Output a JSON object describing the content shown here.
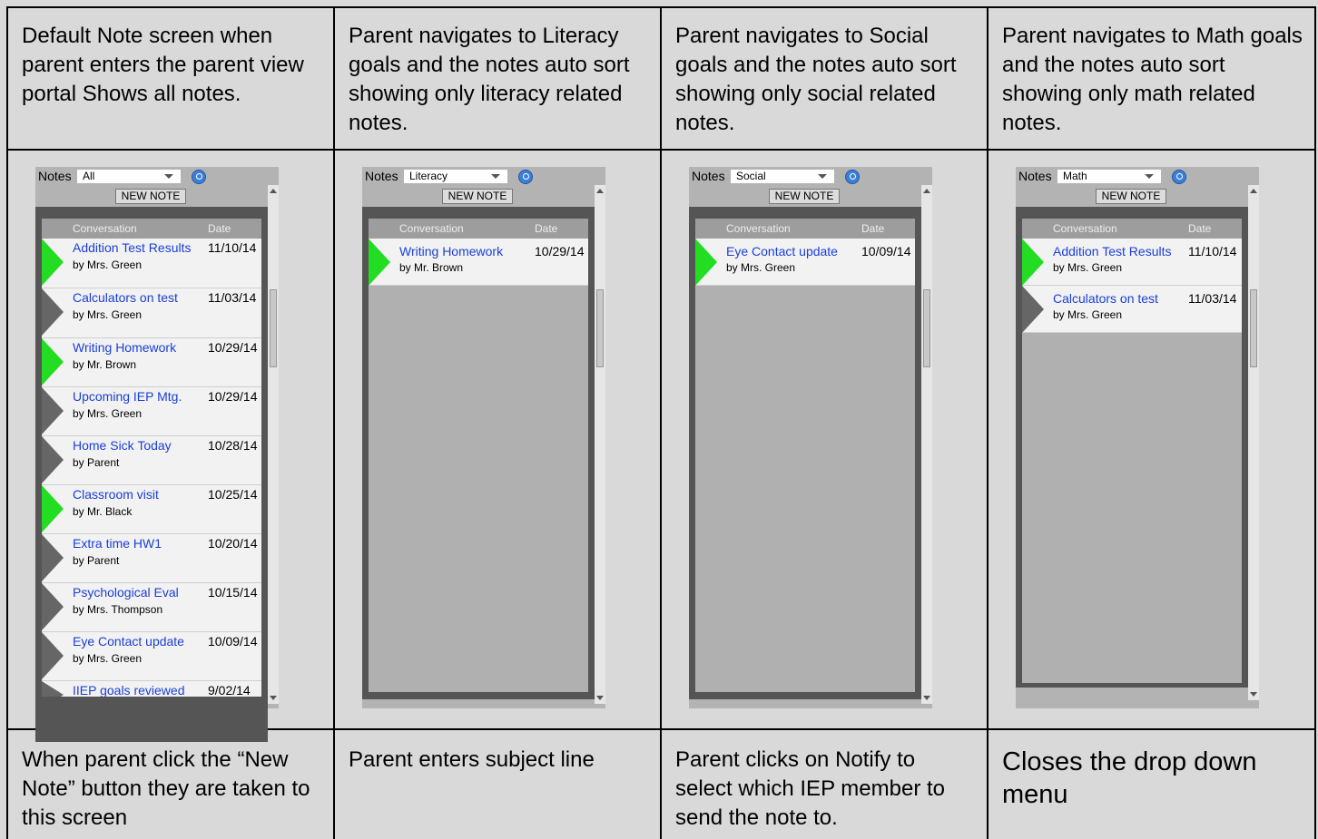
{
  "top_row": [
    "Default Note screen when parent enters the parent view portal Shows all notes.",
    "Parent navigates to Literacy goals and the notes  auto sort showing only literacy related notes.",
    "Parent navigates to Social goals and the notes  auto sort showing only social related notes.",
    "Parent navigates to Math goals and the notes  auto sort showing only math related notes."
  ],
  "bottom_row": [
    "When parent click the “New Note” button they are taken to this screen",
    "Parent enters subject line",
    "Parent clicks on Notify to select which IEP member to send the note to.",
    "Closes the drop down menu"
  ],
  "common": {
    "notes_label": "Notes",
    "new_note_label": "NEW NOTE",
    "col_conversation": "Conversation",
    "col_date": "Date",
    "search_icon": "search-icon",
    "colors": {
      "link": "#1a3fd8",
      "arrow_active": "#22dd22",
      "arrow_inactive": "#666666"
    }
  },
  "panels": [
    {
      "filter": "All",
      "notes": [
        {
          "title": "Addition Test Results",
          "author": "by Mrs. Green",
          "date": "11/10/14",
          "active": true
        },
        {
          "title": "Calculators on test",
          "author": "by Mrs. Green",
          "date": "11/03/14",
          "active": false
        },
        {
          "title": "Writing Homework",
          "author": "by Mr. Brown",
          "date": "10/29/14",
          "active": true
        },
        {
          "title": "Upcoming IEP Mtg.",
          "author": "by Mrs.  Green",
          "date": "10/29/14",
          "active": false
        },
        {
          "title": "Home Sick Today",
          "author": "by Parent",
          "date": "10/28/14",
          "active": false
        },
        {
          "title": "Classroom visit",
          "author": "by Mr. Black",
          "date": "10/25/14",
          "active": true
        },
        {
          "title": "Extra time HW1",
          "author": "by Parent",
          "date": "10/20/14",
          "active": false
        },
        {
          "title": "Psychological Eval",
          "author": "by Mrs.  Thompson",
          "date": "10/15/14",
          "active": false
        },
        {
          "title": "Eye Contact update",
          "author": "by Mrs.  Green",
          "date": "10/09/14",
          "active": false
        },
        {
          "title": "IIEP goals reviewed",
          "author": "",
          "date": "9/02/14",
          "active": false
        }
      ]
    },
    {
      "filter": "Literacy",
      "notes": [
        {
          "title": "Writing Homework",
          "author": "by Mr. Brown",
          "date": "10/29/14",
          "active": true
        }
      ]
    },
    {
      "filter": "Social",
      "notes": [
        {
          "title": "Eye Contact update",
          "author": "by Mrs.  Green",
          "date": "10/09/14",
          "active": true
        }
      ]
    },
    {
      "filter": "Math",
      "notes": [
        {
          "title": "Addition Test Results",
          "author": "by Mrs. Green",
          "date": "11/10/14",
          "active": true
        },
        {
          "title": "Calculators on test",
          "author": "by Mrs. Green",
          "date": "11/03/14",
          "active": false
        }
      ]
    }
  ]
}
